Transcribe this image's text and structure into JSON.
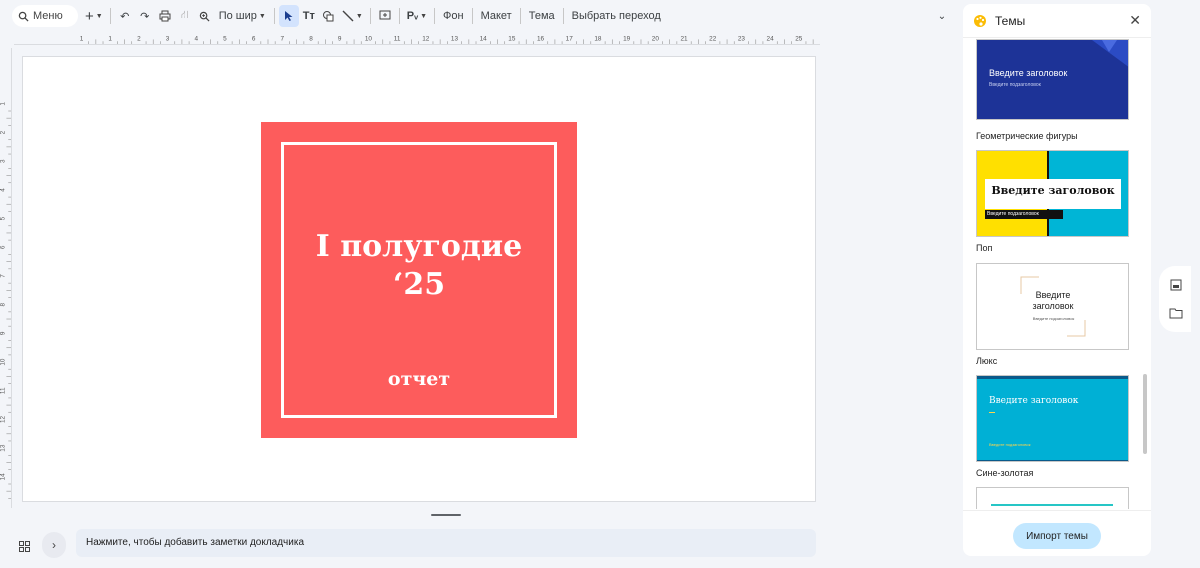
{
  "toolbar": {
    "search_label": "Меню",
    "zoom_label": "По шир",
    "background_label": "Фон",
    "layout_label": "Макет",
    "theme_label": "Тема",
    "transition_label": "Выбрать переход"
  },
  "ruler": {
    "horizontal_ticks": [
      "1",
      "1",
      "2",
      "3",
      "4",
      "5",
      "6",
      "7",
      "8",
      "9",
      "10",
      "11",
      "12",
      "13",
      "14",
      "15",
      "16",
      "17",
      "18",
      "19",
      "20",
      "21",
      "22",
      "23",
      "24",
      "25"
    ],
    "vertical_ticks": [
      "1",
      "2",
      "3",
      "4",
      "5",
      "6",
      "7",
      "8",
      "9",
      "10",
      "11",
      "12",
      "13",
      "14"
    ]
  },
  "slide": {
    "title_line1": "I полугодие",
    "title_line2": "‘25",
    "subtitle": "отчет",
    "card_color": "#fd5c5c"
  },
  "notes": {
    "placeholder": "Нажмите, чтобы добавить заметки докладчика"
  },
  "themes_panel": {
    "title": "Темы",
    "import_button": "Импорт темы",
    "themes": [
      {
        "name": "Геометрические фигуры",
        "thumb_title": "Введите заголовок",
        "thumb_sub": "Введите подзаголовок"
      },
      {
        "name": "Поп",
        "thumb_title": "Введите заголовок",
        "thumb_sub": "Введите подзаголовок"
      },
      {
        "name": "Люкс",
        "thumb_title": "Введите заголовок",
        "thumb_sub": "Введите подзаголовок"
      },
      {
        "name": "Сине-золотая",
        "thumb_title": "Введите заголовок",
        "thumb_sub": "Введите подзаголовок"
      }
    ]
  }
}
